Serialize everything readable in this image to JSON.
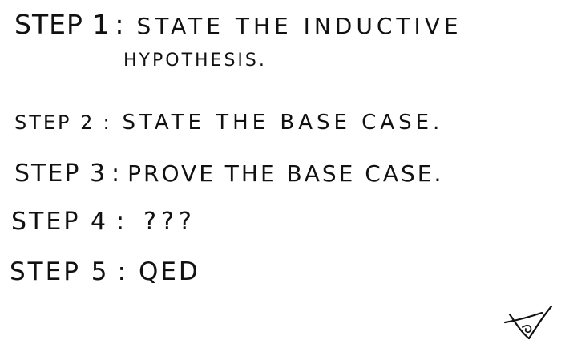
{
  "steps": [
    {
      "label": "STEP 1",
      "text": "STATE THE INDUCTIVE",
      "text_line2": "HYPOTHESIS."
    },
    {
      "label": "STEP 2",
      "text": "STATE THE BASE CASE."
    },
    {
      "label": "STEP 3",
      "text": "PROVE THE BASE CASE."
    },
    {
      "label": "STEP 4",
      "text": "???"
    },
    {
      "label": "STEP 5",
      "text": "QED"
    }
  ],
  "colon": ":",
  "signature": {
    "icon": "handwritten-signature-mark"
  }
}
